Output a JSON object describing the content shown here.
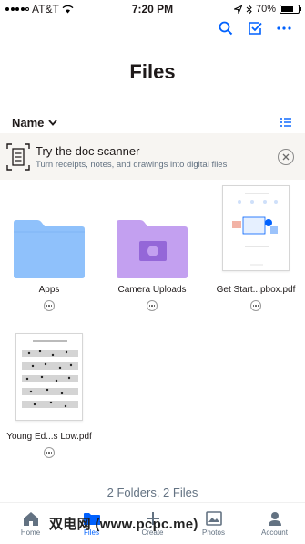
{
  "status_bar": {
    "carrier": "AT&T",
    "time": "7:20 PM",
    "battery_percent": "70%",
    "battery_level": 0.7
  },
  "header": {
    "title": "Files",
    "actions": [
      "search-icon",
      "select-checkbox-icon",
      "more-horizontal-icon"
    ]
  },
  "sort": {
    "label": "Name"
  },
  "banner": {
    "title": "Try the doc scanner",
    "subtitle": "Turn receipts, notes, and drawings into digital files"
  },
  "items": [
    {
      "name": "Apps",
      "kind": "folder",
      "color": "#8fc1fb"
    },
    {
      "name": "Camera Uploads",
      "kind": "folder",
      "color": "#c3a0f0"
    },
    {
      "name": "Get Start...pbox.pdf",
      "kind": "pdf"
    },
    {
      "name": "Young Ed...s Low.pdf",
      "kind": "pdf"
    }
  ],
  "summary": "2 Folders, 2 Files",
  "nav": [
    {
      "label": "Home"
    },
    {
      "label": "Files"
    },
    {
      "label": "Create"
    },
    {
      "label": "Photos"
    },
    {
      "label": "Account"
    }
  ],
  "accent_color": "#0061fe",
  "watermark": "双电网 (www.pcpc.me)"
}
